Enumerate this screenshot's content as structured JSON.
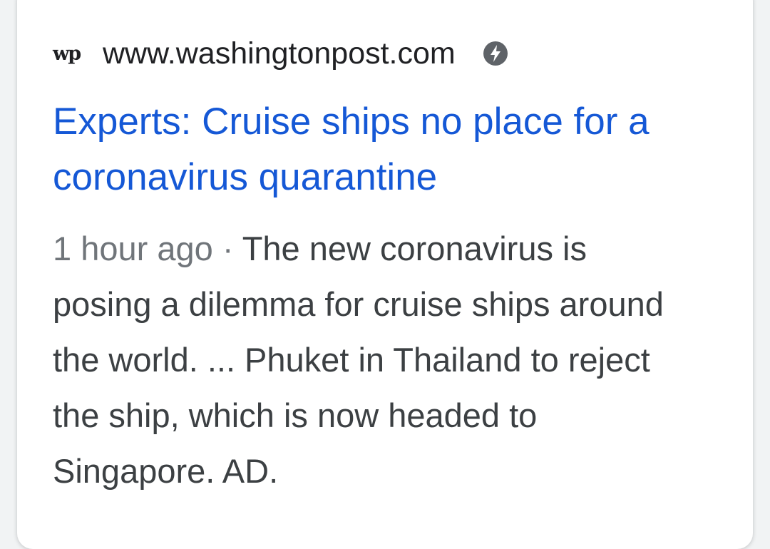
{
  "result": {
    "favicon_text": "wp",
    "url": "www.washingtonpost.com",
    "amp_icon": "amp-lightning-icon",
    "title": "Experts: Cruise ships no place for a coronavirus quarantine",
    "time": "1 hour ago",
    "separator": "·",
    "snippet": "The new coronavirus is posing a dilemma for cruise ships around the world. ... Phuket in Thailand to reject the ship, which is now headed to Singapore. AD."
  },
  "colors": {
    "title": "#1558d6",
    "snippet": "#3c4043",
    "time": "#70757a",
    "url": "#202124"
  }
}
